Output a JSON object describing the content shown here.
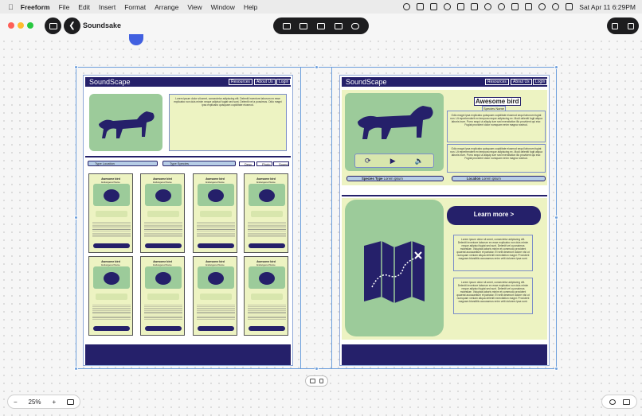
{
  "menubar": {
    "app_name": "Freeform",
    "items": [
      "File",
      "Edit",
      "Insert",
      "Format",
      "Arrange",
      "View",
      "Window",
      "Help"
    ],
    "clock": "Sat Apr 11  6:29PM"
  },
  "toolbar": {
    "board_title": "Soundsake"
  },
  "left_frame": {
    "logo": "SoundScape",
    "nav": [
      "Resources",
      "About Us",
      "Login"
    ],
    "intro_text": "Lorem ipsum dolor sit amet, consectetur adipiscing elit. Deleniti inventore laborum ex esse explicabo non duis minim neque adipisci fugiat sed sunt. Deleniti vel a possimus. Odio magni ipsa explicabo quisquam cupiditate eiusmod.",
    "filters": {
      "location": "Type Location",
      "species": "Type Species",
      "checks": [
        "Desc",
        "Photo",
        "Sound"
      ]
    },
    "cards": [
      {
        "title": "Awesome bird",
        "subtitle": "Endangered Name",
        "desc_label": "Description:"
      },
      {
        "title": "Awesome bird",
        "subtitle": "Endangered Name",
        "desc_label": "Description:"
      },
      {
        "title": "Awesome bird",
        "subtitle": "Endangered Name",
        "desc_label": "Description:"
      },
      {
        "title": "Awesome bird",
        "subtitle": "Endangered Name",
        "desc_label": "Description:"
      },
      {
        "title": "Awesome bird",
        "subtitle": "Endangered Name",
        "desc_label": "Description:"
      },
      {
        "title": "Awesome bird",
        "subtitle": "Endangered Name",
        "desc_label": "Description:"
      },
      {
        "title": "Awesome bird",
        "subtitle": "Endangered Name",
        "desc_label": "Description:"
      },
      {
        "title": "Awesome bird",
        "subtitle": "Endangered Name",
        "desc_label": "Description:"
      }
    ]
  },
  "right_frame": {
    "logo": "SoundScape",
    "nav": [
      "Resources",
      "About Us",
      "Login"
    ],
    "bird_title": "Awesome bird",
    "species_name": "Species Name",
    "bird_text_1": "Odio magni ipsa explicabo quisquam cupiditate eiusmod sequi laborum fugiat non. Ut reprehenderit ex tempora neque adipiscing ex. Modi deleniti fugit aliqua laboris irure. Porro sequi ut aliquip iure sed exercitation illo provident qui eiur. Fugiat provident dolor numquam enim magna nostrud.",
    "bird_text_2": "Odio magni ipsa explicabo quisquam cupiditate eiusmod sequi laborum fugiat non. Ut reprehenderit ex tempora neque adipiscing ex. Modi deleniti fugit aliqua laboris irure. Porro sequi ut aliquip iure sed exercitation illo provident qui eiur. Fugiat provident dolor numquam enim magna nostrud.",
    "species_type_label": "Species Type",
    "species_type_value": "Lorem ipsum",
    "location_label": "Location",
    "location_value": "Lorem ipsum",
    "learn_more": "Learn more >",
    "para_1": "Lorem ipsum dolor sit amet, consectetur adipiscing elit. Deleniti inventore laborum ex esse explicabo non duis minim neque adipisci fugiat sed sunt. Deleniti vel a possimus molestiae. Voluptas laboris minim et commodo provident quaerat accusantium et pariatur. Et velit deserunt dolore nisi ut numquam veniam aliqua deleniti exercitation magni. Provident magnam blanditiis accusamus enim velit dolorem ipsa sunt.",
    "para_2": "Lorem ipsum dolor sit amet, consectetur adipiscing elit. Deleniti inventore laborum ex esse explicabo non duis minim neque adipisci fugiat sed sunt. Deleniti vel a possimus molestiae. Voluptas laboris minim et commodo provident quaerat accusantium et pariatur. Et velit deserunt dolore nisi ut numquam veniam aliqua deleniti exercitation magni. Provident magnam blanditiis accusamus enim velit dolorem ipsa sunt."
  },
  "bottom": {
    "zoom_level": "25%",
    "zoom_out": "−",
    "zoom_in": "+"
  },
  "colors": {
    "navy": "#25206a",
    "green": "#9ccb9a",
    "cream": "#edf3c2",
    "selection": "#6d9fdc"
  }
}
